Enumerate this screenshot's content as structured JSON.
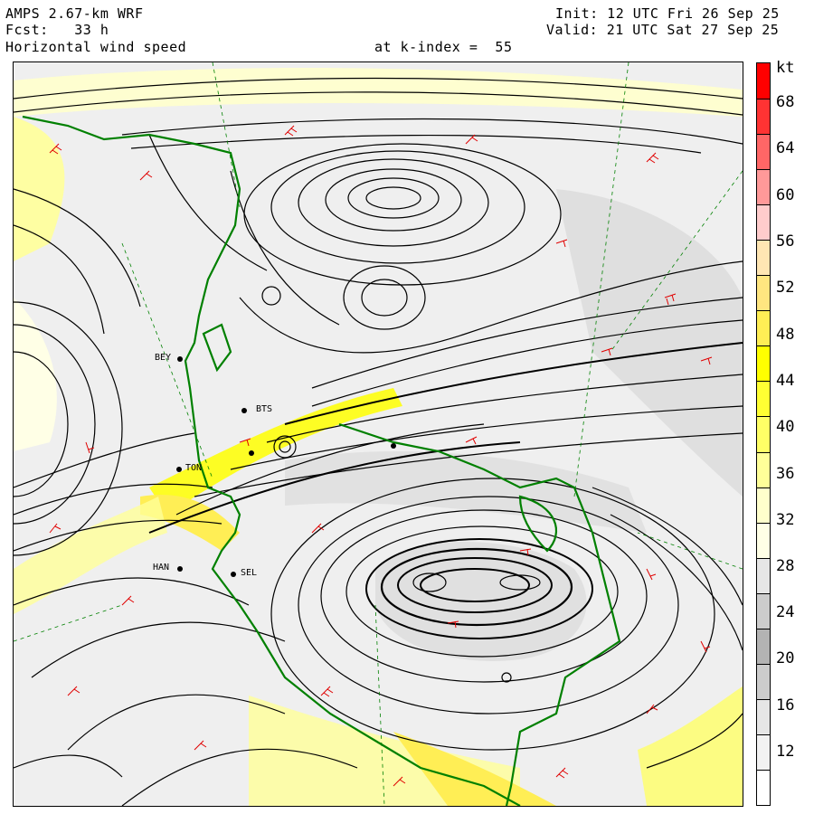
{
  "header": {
    "model": "AMPS 2.67-km WRF",
    "forecast": "Fcst:   33 h",
    "field": "Horizontal wind speed",
    "level": "at k-index =  55",
    "init": "Init: 12 UTC Fri 26 Sep 25",
    "valid": "Valid: 21 UTC Sat 27 Sep 25"
  },
  "colorbar": {
    "unit": "kt",
    "ticks": [
      "68",
      "64",
      "60",
      "56",
      "52",
      "48",
      "44",
      "40",
      "36",
      "32",
      "28",
      "24",
      "20",
      "16",
      "12"
    ],
    "colors": [
      "#ff0000",
      "#ff3333",
      "#ff6666",
      "#ff9999",
      "#ffcccc",
      "#ffe6b3",
      "#ffe680",
      "#ffee55",
      "#ffff00",
      "#ffff33",
      "#ffff66",
      "#ffff99",
      "#ffffcc",
      "#ffffe6",
      "#e6e6e6",
      "#cccccc",
      "#b3b3b3",
      "#cccccc",
      "#e6e6e6",
      "#f2f2f2",
      "#ffffff"
    ]
  },
  "stations": [
    {
      "code": "BTS"
    },
    {
      "code": "TON"
    },
    {
      "code": "HAN"
    },
    {
      "code": "SEL"
    },
    {
      "code": "BEY"
    }
  ]
}
